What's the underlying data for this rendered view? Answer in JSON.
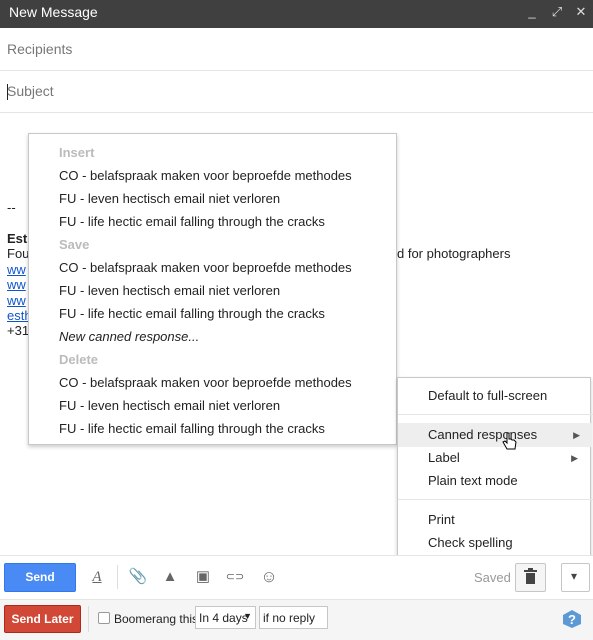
{
  "window": {
    "title": "New Message",
    "minimize": "_",
    "expand": "⤢",
    "close": "✕"
  },
  "compose": {
    "recipients_placeholder": "Recipients",
    "subject_placeholder": "Subject",
    "body": {
      "sig_sep": "--",
      "name_frag": "Esth",
      "line2_left": "Fou",
      "line2_right": "d for photographers",
      "link1": "ww",
      "link2": "ww",
      "link3": "ww",
      "link4": "esth",
      "phone_frag": "+31"
    }
  },
  "canned_menu": {
    "insert_header": "Insert",
    "insert_items": [
      "CO - belafspraak maken voor beproefde methodes",
      "FU - leven hectisch email niet verloren",
      "FU - life hectic email falling through the cracks"
    ],
    "save_header": "Save",
    "save_items": [
      "CO - belafspraak maken voor beproefde methodes",
      "FU - leven hectisch email niet verloren",
      "FU - life hectic email falling through the cracks"
    ],
    "new_response": "New canned response...",
    "delete_header": "Delete",
    "delete_items": [
      "CO - belafspraak maken voor beproefde methodes",
      "FU - leven hectisch email niet verloren",
      "FU - life hectic email falling through the cracks"
    ]
  },
  "options_menu": {
    "full_screen": "Default to full-screen",
    "canned": "Canned responses",
    "label": "Label",
    "plain_text": "Plain text mode",
    "print": "Print",
    "spelling": "Check spelling",
    "submenu_arrow": "▶"
  },
  "toolbar": {
    "send": "Send",
    "saved": "Saved",
    "icons": {
      "format": "A",
      "attach": "📎",
      "drive": "▲",
      "photo": "▣",
      "link": "⊂⊃",
      "emoji": "☺",
      "trash": "🗑",
      "more": "▾"
    }
  },
  "boomerang": {
    "send_later": "Send Later",
    "label": "Boomerang this",
    "delay": "In 4 days",
    "condition": "if no reply",
    "help": "?"
  },
  "colors": {
    "send_blue": "#4a8af4",
    "send_later_red": "#d14836",
    "titlebar": "#404040"
  }
}
